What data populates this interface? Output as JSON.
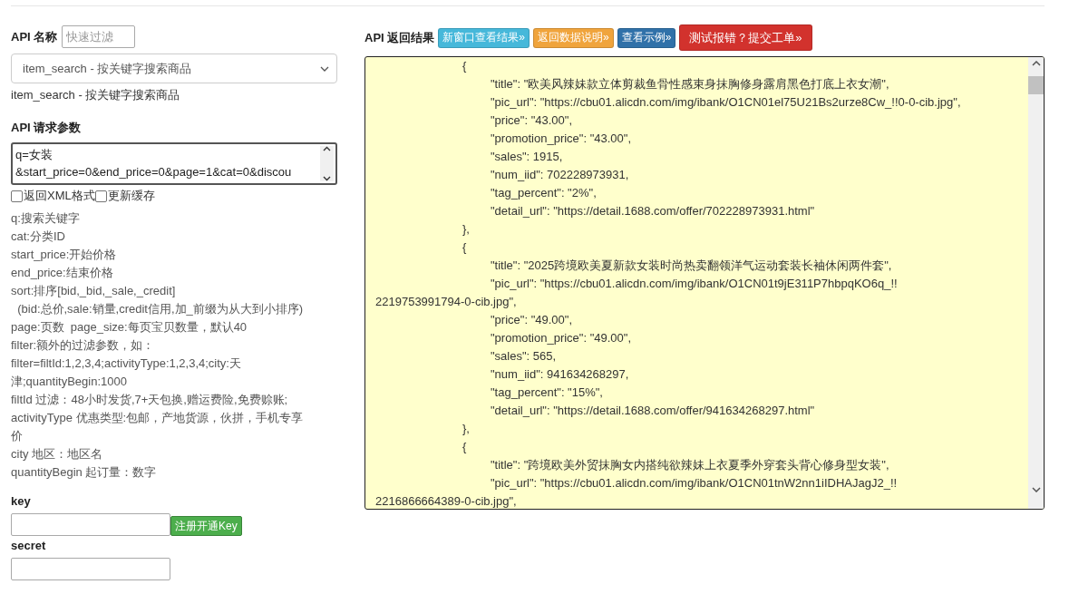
{
  "api_name": {
    "label": "API 名称",
    "filter_placeholder": "快速过滤",
    "selected_api": "item_search - 按关键字搜索商品",
    "description": "item_search - 按关键字搜索商品"
  },
  "params": {
    "label": "API 请求参数",
    "value_lines": [
      "q=女装",
      "&start_price=0&end_price=0&page=1&cat=0&discou"
    ],
    "options": [
      {
        "label": "返回XML格式",
        "checked": false
      },
      {
        "label": "更新缓存",
        "checked": false
      }
    ],
    "help": [
      "q:搜索关键字",
      "cat:分类ID",
      "start_price:开始价格",
      "end_price:结束价格",
      "sort:排序[bid,_bid,_sale,_credit]",
      "  (bid:总价,sale:销量,credit信用,加_前缀为从大到小排序)",
      "page:页数  page_size:每页宝贝数量，默认40",
      "filter:额外的过滤参数，如：",
      "filter=filtId:1,2,3,4;activityType:1,2,3,4;city:天",
      "津;quantityBegin:1000",
      "filtId 过滤：48小时发货,7+天包换,赠运费险,免费赊账;",
      "activityType 优惠类型:包邮，产地货源，伙拼，手机专享",
      "价",
      "city 地区：地区名",
      "quantityBegin 起订量：数字"
    ]
  },
  "key": {
    "label": "key",
    "register_button": "注册开通Key"
  },
  "secret": {
    "label": "secret"
  },
  "result": {
    "label": "API 返回结果",
    "buttons": [
      {
        "label": "新窗口查看结果»",
        "color": "#46b8da",
        "kind": "small"
      },
      {
        "label": "返回数据说明»",
        "color": "#f0a43c",
        "kind": "small"
      },
      {
        "label": "查看示例»",
        "color": "#3071a9",
        "kind": "small"
      },
      {
        "label": "测试报错？提交工单»",
        "color": "#d2322d",
        "kind": "large"
      }
    ],
    "lines": [
      {
        "kind": "brace",
        "text": "{"
      },
      {
        "kind": "field",
        "text": "\"title\": \"欧美风辣妹款立体剪裁鱼骨性感束身抹胸修身露肩黑色打底上衣女潮\","
      },
      {
        "kind": "field",
        "text": "\"pic_url\": \"https://cbu01.alicdn.com/img/ibank/O1CN01el75U21Bs2urze8Cw_!!0-0-cib.jpg\","
      },
      {
        "kind": "field",
        "text": "\"price\": \"43.00\","
      },
      {
        "kind": "field",
        "text": "\"promotion_price\": \"43.00\","
      },
      {
        "kind": "field",
        "text": "\"sales\": 1915,"
      },
      {
        "kind": "field",
        "text": "\"num_iid\": 702228973931,"
      },
      {
        "kind": "field",
        "text": "\"tag_percent\": \"2%\","
      },
      {
        "kind": "field",
        "text": "\"detail_url\": \"https://detail.1688.com/offer/702228973931.html\""
      },
      {
        "kind": "brace",
        "text": "},"
      },
      {
        "kind": "brace",
        "text": "{"
      },
      {
        "kind": "field",
        "text": "\"title\": \"2025跨境欧美夏新款女装时尚热卖翻领洋气运动套装长袖休闲两件套\","
      },
      {
        "kind": "field",
        "text": "\"pic_url\": \"https://cbu01.alicdn.com/img/ibank/O1CN01t9jE311P7hbpqKO6q_!!"
      },
      {
        "kind": "wrap",
        "text": "2219753991794-0-cib.jpg\","
      },
      {
        "kind": "field",
        "text": "\"price\": \"49.00\","
      },
      {
        "kind": "field",
        "text": "\"promotion_price\": \"49.00\","
      },
      {
        "kind": "field",
        "text": "\"sales\": 565,"
      },
      {
        "kind": "field",
        "text": "\"num_iid\": 941634268297,"
      },
      {
        "kind": "field",
        "text": "\"tag_percent\": \"15%\","
      },
      {
        "kind": "field",
        "text": "\"detail_url\": \"https://detail.1688.com/offer/941634268297.html\""
      },
      {
        "kind": "brace",
        "text": "},"
      },
      {
        "kind": "brace",
        "text": "{"
      },
      {
        "kind": "field",
        "text": "\"title\": \"跨境欧美外贸抹胸女内搭纯欲辣妹上衣夏季外穿套头背心修身型女装\","
      },
      {
        "kind": "field",
        "text": "\"pic_url\": \"https://cbu01.alicdn.com/img/ibank/O1CN01tnW2nn1iIDHAJagJ2_!!"
      },
      {
        "kind": "wrap",
        "text": "2216866664389-0-cib.jpg\","
      }
    ]
  }
}
